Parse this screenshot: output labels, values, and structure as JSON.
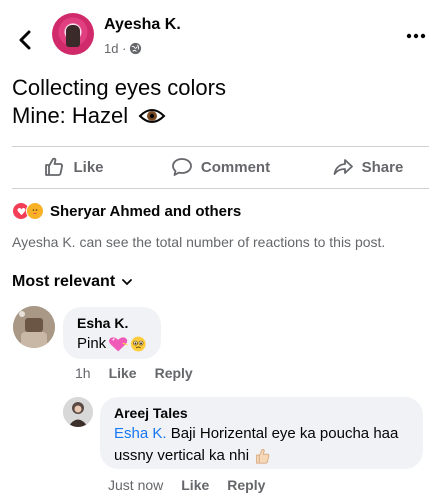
{
  "post": {
    "author": "Ayesha K.",
    "time": "1d ·",
    "lines": [
      "Collecting eyes colors",
      "Mine:  Hazel"
    ]
  },
  "actions": {
    "like": "Like",
    "comment": "Comment",
    "share": "Share"
  },
  "reactions": {
    "reactors": "Sheryar Ahmed and others",
    "visibility_note": "Ayesha K. can see the total number of reactions to this post."
  },
  "comments_sort": "Most relevant",
  "comments": [
    {
      "author": "Esha K.",
      "text": "Pink",
      "time": "1h",
      "like": "Like",
      "reply": "Reply"
    },
    {
      "author": "Areej Tales",
      "mention": "Esha K.",
      "text": " Baji Horizental eye ka poucha haa ussny vertical ka nhi",
      "time": "Just now",
      "like": "Like",
      "reply": "Reply"
    }
  ],
  "colors": {
    "text": "#050505",
    "secondary": "#65676b",
    "mention": "#1877f2",
    "bubble": "#f0f2f5",
    "love": "#f33e58",
    "care": "#f7b125"
  },
  "icons": [
    "back-arrow-icon",
    "more-options-icon",
    "globe-icon",
    "eye-icon",
    "like-thumb-icon",
    "comment-bubble-icon",
    "share-arrow-icon",
    "love-reaction-icon",
    "care-reaction-icon",
    "chevron-down-icon",
    "heart-emoji-icon",
    "pleading-face-emoji-icon",
    "thumbs-up-emoji-icon"
  ]
}
